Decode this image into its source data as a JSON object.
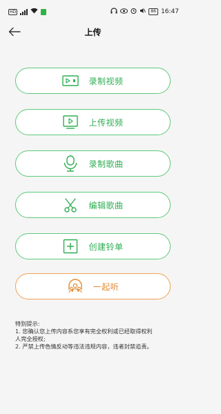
{
  "status_bar": {
    "hd_tag": "HD",
    "battery": "86",
    "time": "16:47"
  },
  "header": {
    "title": "上传"
  },
  "actions": [
    {
      "label": "录制视频",
      "icon": "video-camera-icon"
    },
    {
      "label": "上传视频",
      "icon": "play-screen-icon"
    },
    {
      "label": "录制歌曲",
      "icon": "microphone-icon"
    },
    {
      "label": "编辑歌曲",
      "icon": "scissors-icon"
    },
    {
      "label": "创建铃单",
      "icon": "add-box-icon"
    },
    {
      "label": "一起听",
      "icon": "listen-together-icon"
    }
  ],
  "colors": {
    "green": "#2fae52",
    "green_border": "#5ec97a",
    "orange": "#e0892f",
    "orange_border": "#f0a050"
  },
  "notice": {
    "title": "特别提示:",
    "lines": [
      "1. 您确认您上传内容系您享有完全权利或已经取得权利",
      "人完全授权;",
      "2. 严禁上传色情反动等违法违规内容，违者封禁追责。"
    ]
  }
}
